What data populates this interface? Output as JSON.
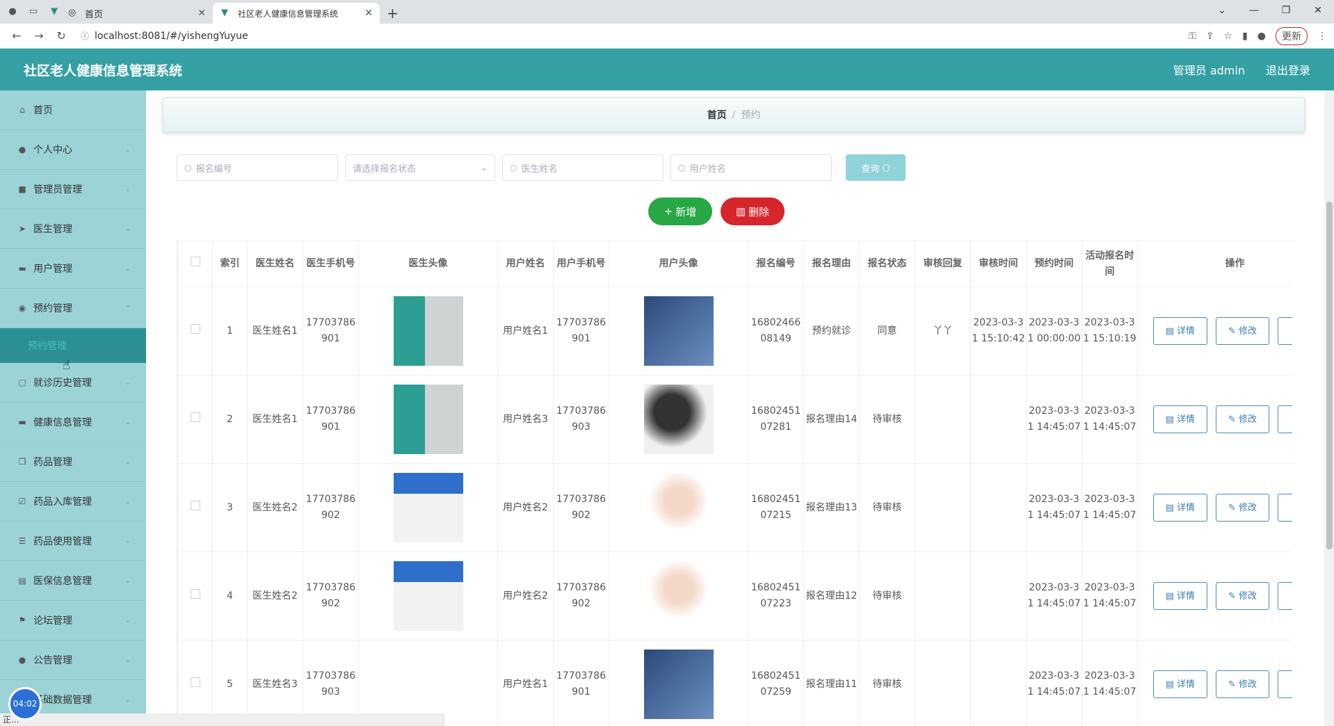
{
  "browser": {
    "tab_inactive": "首页",
    "tab_active": "社区老人健康信息管理系统",
    "url": "localhost:8081/#/yishengYuyue",
    "update_label": "更新"
  },
  "header": {
    "title": "社区老人健康信息管理系统",
    "user": "管理员 admin",
    "logout": "退出登录"
  },
  "sidebar": {
    "items": [
      {
        "label": "首页",
        "icon": "home-icon"
      },
      {
        "label": "个人中心",
        "icon": "user-icon"
      },
      {
        "label": "管理员管理",
        "icon": "briefcase-icon"
      },
      {
        "label": "医生管理",
        "icon": "send-icon"
      },
      {
        "label": "用户管理",
        "icon": "phone-icon"
      },
      {
        "label": "预约管理",
        "icon": "location-icon"
      }
    ],
    "sub_active": "预约管理",
    "items2": [
      {
        "label": "就诊历史管理",
        "icon": "chat-icon"
      },
      {
        "label": "健康信息管理",
        "icon": "card-icon"
      },
      {
        "label": "药品管理",
        "icon": "copy-icon"
      },
      {
        "label": "药品入库管理",
        "icon": "check-icon"
      },
      {
        "label": "药品使用管理",
        "icon": "list-icon"
      },
      {
        "label": "医保信息管理",
        "icon": "doc-icon"
      },
      {
        "label": "论坛管理",
        "icon": "flag-icon"
      },
      {
        "label": "公告管理",
        "icon": "person-icon"
      },
      {
        "label": "基础数据管理",
        "icon": "data-icon"
      }
    ]
  },
  "breadcrumb": {
    "home": "首页",
    "current": "预约"
  },
  "filters": {
    "baoming_placeholder": "报名编号",
    "status_placeholder": "请选择报名状态",
    "doctor_placeholder": "医生姓名",
    "user_placeholder": "用户姓名",
    "query_label": "查询"
  },
  "actions": {
    "add": "新增",
    "delete": "删除"
  },
  "table": {
    "headers": [
      "索引",
      "医生姓名",
      "医生手机号",
      "医生头像",
      "用户姓名",
      "用户手机号",
      "用户头像",
      "报名编号",
      "报名理由",
      "报名状态",
      "审核回复",
      "审核时间",
      "预约时间",
      "活动报名时间",
      "操作"
    ],
    "detail_label": "详情",
    "edit_label": "修改",
    "rows": [
      {
        "index": "1",
        "doctor": "医生姓名1",
        "doctor_phone": "17703786901",
        "doctor_img": "doc1",
        "user": "用户姓名1",
        "user_phone": "17703786901",
        "user_img": "usr-blue",
        "no": "1680246608149",
        "reason": "预约就诊",
        "status": "同意",
        "reply": "丫丫",
        "audit_time": "2023-03-31 15:10:42",
        "appt_time": "2023-03-31 00:00:00",
        "signup_time": "2023-03-31 15:10:19"
      },
      {
        "index": "2",
        "doctor": "医生姓名1",
        "doctor_phone": "17703786901",
        "doctor_img": "doc1",
        "user": "用户姓名3",
        "user_phone": "17703786903",
        "user_img": "usr-dark",
        "no": "1680245107281",
        "reason": "报名理由14",
        "status": "待审核",
        "reply": "",
        "audit_time": "",
        "appt_time": "2023-03-31 14:45:07",
        "signup_time": "2023-03-31 14:45:07"
      },
      {
        "index": "3",
        "doctor": "医生姓名2",
        "doctor_phone": "17703786902",
        "doctor_img": "doc2",
        "user": "用户姓名2",
        "user_phone": "17703786902",
        "user_img": "usr-girl",
        "no": "1680245107215",
        "reason": "报名理由13",
        "status": "待审核",
        "reply": "",
        "audit_time": "",
        "appt_time": "2023-03-31 14:45:07",
        "signup_time": "2023-03-31 14:45:07"
      },
      {
        "index": "4",
        "doctor": "医生姓名2",
        "doctor_phone": "17703786902",
        "doctor_img": "doc2",
        "user": "用户姓名2",
        "user_phone": "17703786902",
        "user_img": "usr-girl",
        "no": "1680245107223",
        "reason": "报名理由12",
        "status": "待审核",
        "reply": "",
        "audit_time": "",
        "appt_time": "2023-03-31 14:45:07",
        "signup_time": "2023-03-31 14:45:07"
      },
      {
        "index": "5",
        "doctor": "医生姓名3",
        "doctor_phone": "17703786903",
        "doctor_img": "",
        "user": "用户姓名1",
        "user_phone": "17703786901",
        "user_img": "usr-blue",
        "no": "1680245107259",
        "reason": "报名理由11",
        "status": "待审核",
        "reply": "",
        "audit_time": "",
        "appt_time": "2023-03-31 14:45:07",
        "signup_time": "2023-03-31 14:45:07"
      }
    ]
  },
  "timer": "04:02",
  "statusbar": "正..."
}
